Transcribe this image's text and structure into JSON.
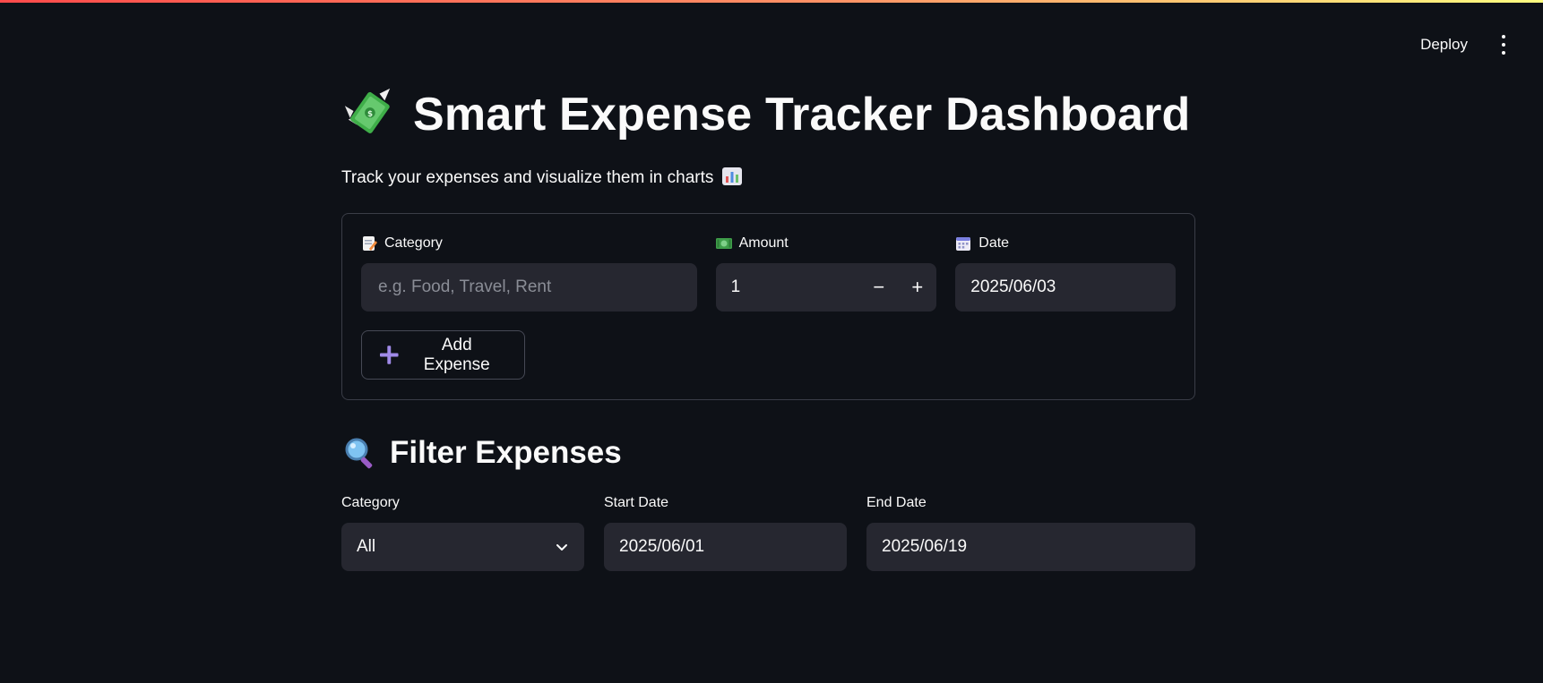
{
  "header": {
    "deploy_label": "Deploy"
  },
  "page": {
    "title": "Smart Expense Tracker Dashboard",
    "subtitle": "Track your expenses and visualize them in charts"
  },
  "form": {
    "category": {
      "label": "Category",
      "placeholder": "e.g. Food, Travel, Rent",
      "value": ""
    },
    "amount": {
      "label": "Amount",
      "value": "1",
      "decrement": "−",
      "increment": "+"
    },
    "date": {
      "label": "Date",
      "value": "2025/06/03"
    },
    "add_button_label": "Add Expense"
  },
  "filter": {
    "title": "Filter Expenses",
    "category": {
      "label": "Category",
      "selected": "All"
    },
    "start_date": {
      "label": "Start Date",
      "value": "2025/06/01"
    },
    "end_date": {
      "label": "End Date",
      "value": "2025/06/19"
    }
  },
  "icons": {
    "title": "money-with-wings-icon",
    "subtitle": "bar-chart-icon",
    "category": "memo-icon",
    "amount": "dollar-banknote-icon",
    "date": "calendar-icon",
    "add": "plus-icon",
    "filter": "magnifying-glass-icon",
    "select": "chevron-down-icon",
    "menu": "kebab-menu-icon"
  },
  "colors": {
    "background": "#0e1117",
    "input_background": "#262730",
    "text": "#fafafa",
    "border": "#3a3d47",
    "accent_plus": "#a08ae8"
  }
}
